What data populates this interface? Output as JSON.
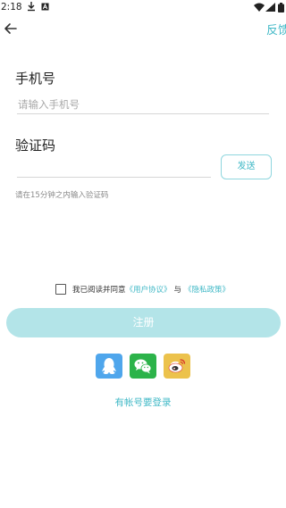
{
  "status_bar": {
    "time": "2:18",
    "icons": [
      "download-icon",
      "a-icon",
      "wifi-icon",
      "signal-icon",
      "battery-icon"
    ]
  },
  "header": {
    "back_icon": "arrow-left-icon",
    "feedback_label": "反馈"
  },
  "form": {
    "phone_label": "手机号",
    "phone_placeholder": "请输入手机号",
    "phone_value": "",
    "code_label": "验证码",
    "code_value": "",
    "send_label": "发送",
    "hint": "请在15分钟之内输入验证码"
  },
  "agreement": {
    "checked": false,
    "prefix": "我已阅读并同意",
    "user_agreement": "《用户协议》",
    "conjunction": "与",
    "privacy_policy": "《隐私政策》"
  },
  "register_label": "注册",
  "social_login": [
    {
      "name": "qq",
      "icon": "qq-icon",
      "color": "#4fa6ec"
    },
    {
      "name": "wechat",
      "icon": "wechat-icon",
      "color": "#2cb34a"
    },
    {
      "name": "weibo",
      "icon": "weibo-icon",
      "color": "#ecc24c"
    }
  ],
  "login_link": "有帐号要登录",
  "colors": {
    "accent": "#3fb8c6",
    "register_button": "#b3e4e8"
  }
}
